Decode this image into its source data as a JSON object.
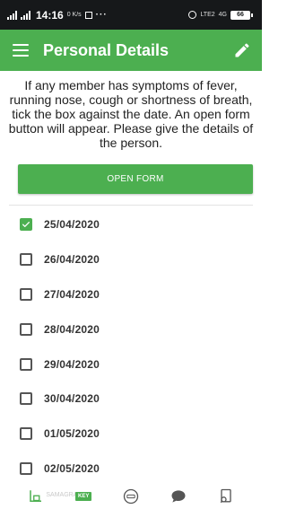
{
  "status_bar": {
    "left_small": "R",
    "time": "14:16",
    "net_speed": "0 K/s",
    "dots": "···",
    "lte_label": "LTE2",
    "network_label": "4G",
    "battery": "66"
  },
  "app_bar": {
    "title": "Personal Details"
  },
  "instructions": "If any member has symptoms of fever, running nose, cough or shortness of breath, tick the box against the date. An open form button will appear. Please give the details of the person.",
  "open_form_button": "OPEN FORM",
  "dates": [
    {
      "label": "25/04/2020",
      "checked": true
    },
    {
      "label": "26/04/2020",
      "checked": false
    },
    {
      "label": "27/04/2020",
      "checked": false
    },
    {
      "label": "28/04/2020",
      "checked": false
    },
    {
      "label": "29/04/2020",
      "checked": false
    },
    {
      "label": "30/04/2020",
      "checked": false
    },
    {
      "label": "01/05/2020",
      "checked": false
    },
    {
      "label": "02/05/2020",
      "checked": false
    }
  ],
  "bottom_nav": {
    "key_label": "KEY",
    "faded_text": "SAMAGRA"
  },
  "colors": {
    "primary": "#4caf50",
    "status_bar": "#16181a",
    "text": "#222222"
  }
}
